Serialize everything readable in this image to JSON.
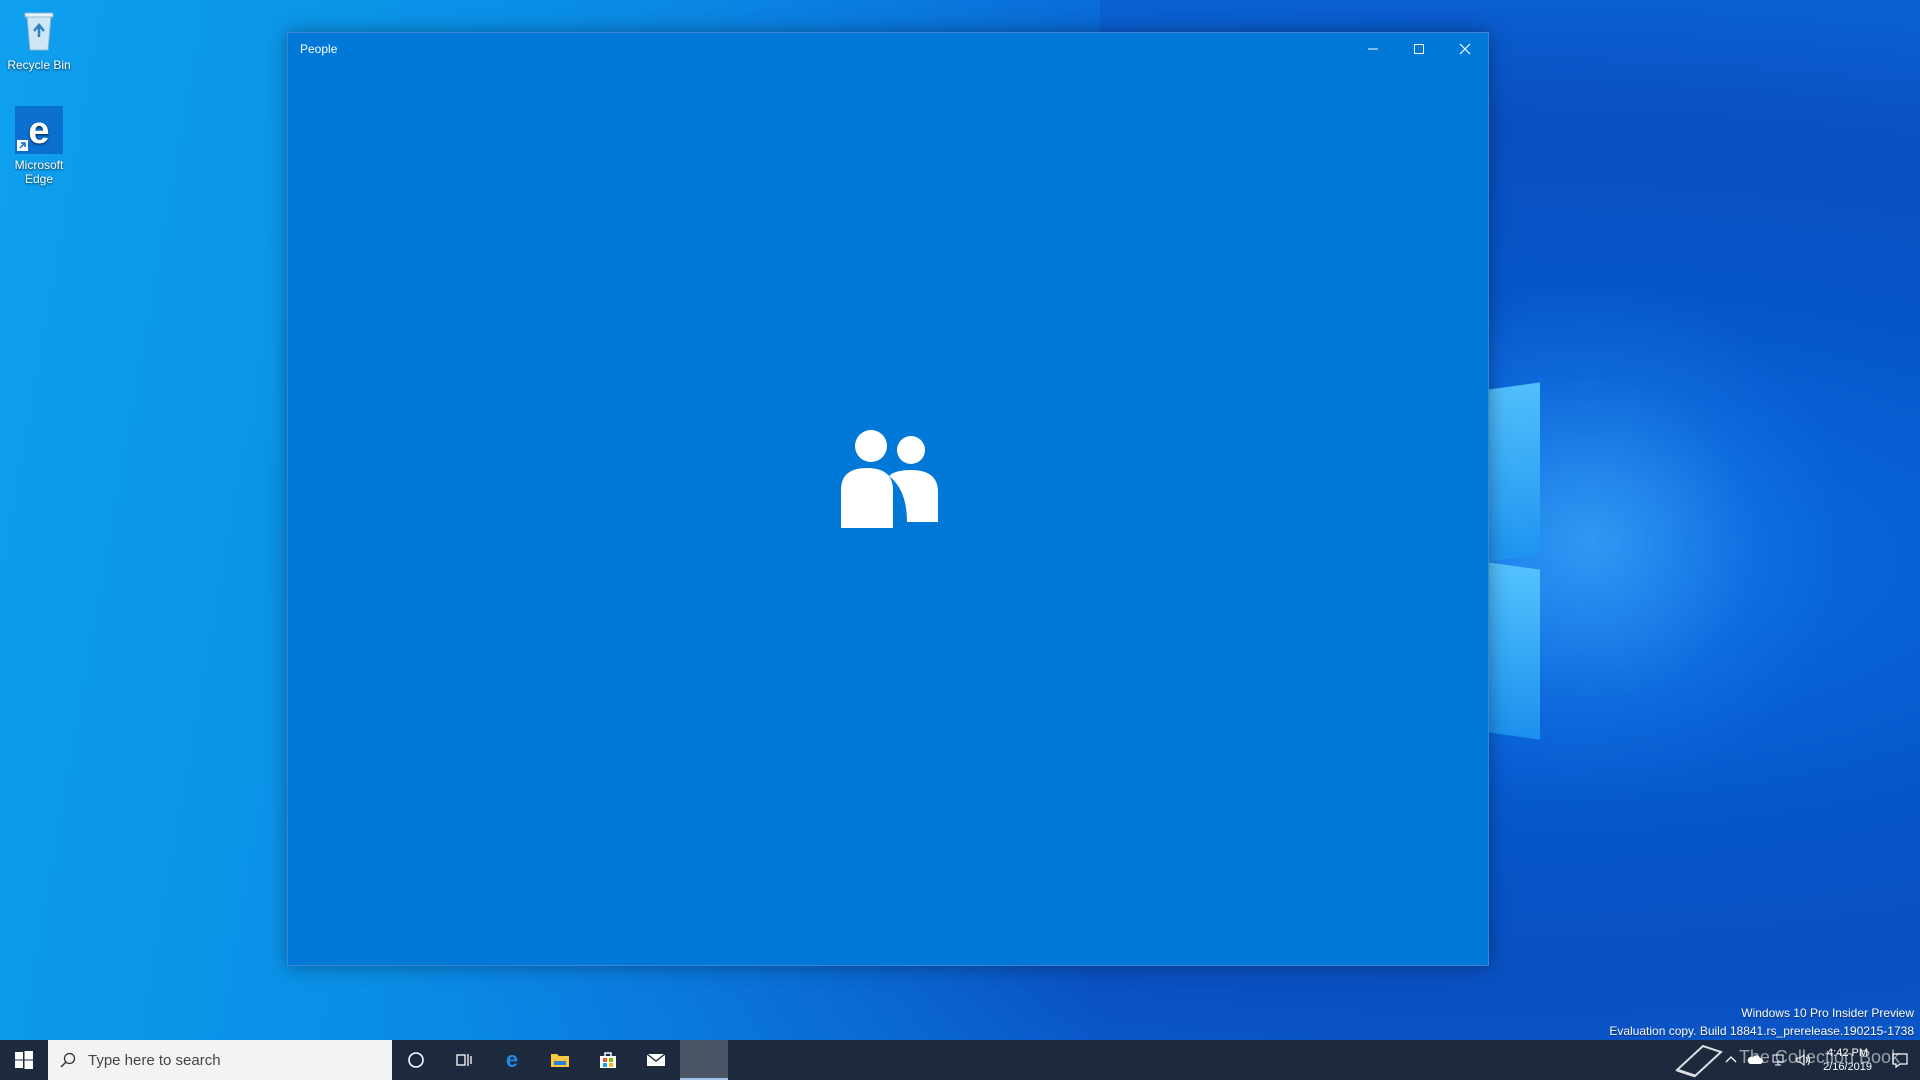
{
  "desktop": {
    "icons": [
      {
        "label": "Recycle Bin",
        "icon": "recycle-bin-icon"
      },
      {
        "label": "Microsoft Edge",
        "icon": "edge-icon"
      }
    ],
    "watermark_line1": "Windows 10 Pro Insider Preview",
    "watermark_line2": "Evaluation copy. Build 18841.rs_prerelease.190215-1738"
  },
  "window": {
    "title": "People",
    "controls": [
      "minimize-icon",
      "maximize-icon",
      "close-icon"
    ],
    "splash_icon": "people-icon",
    "background_color": "#0078d7"
  },
  "taskbar": {
    "search_placeholder": "Type here to search",
    "pinned": [
      "cortana-icon",
      "task-view-icon",
      "edge-icon",
      "file-explorer-icon",
      "store-icon",
      "mail-icon",
      "people-app-icon"
    ],
    "clock_time": "4:42 PM",
    "clock_date": "2/16/2019",
    "overlay_watermark": "The Collection Book"
  }
}
